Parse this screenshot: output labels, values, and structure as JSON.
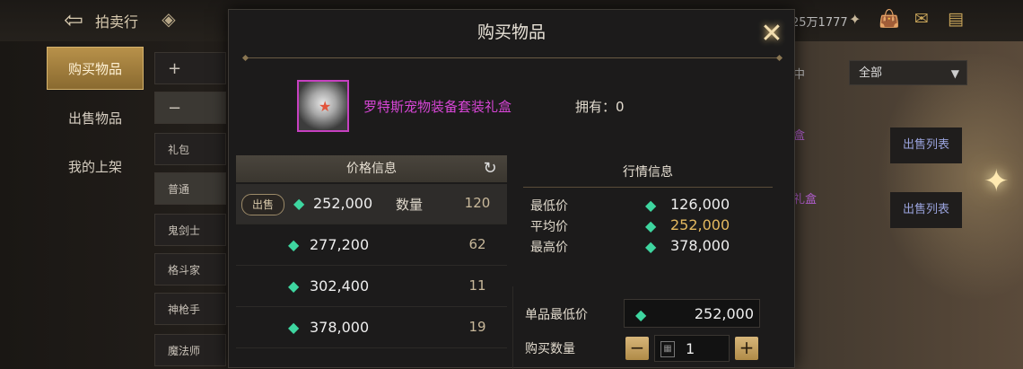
{
  "topbar": {
    "title": "拍卖行",
    "currency": "25万1777"
  },
  "sidebar": {
    "items": [
      {
        "label": "购买物品",
        "active": true
      },
      {
        "label": "出售物品",
        "active": false
      },
      {
        "label": "我的上架",
        "active": false
      }
    ]
  },
  "filters": {
    "plus": "+",
    "minus": "−",
    "items": [
      "礼包",
      "普通",
      "鬼剑士",
      "格斗家",
      "神枪手",
      "魔法师"
    ]
  },
  "right": {
    "partial_label": "中",
    "dropdown": "全部",
    "row1_label": "盒",
    "row2_label": "礼盒",
    "list_button": "出售列表"
  },
  "modal": {
    "title": "购买物品",
    "item_name": "罗特斯宠物装备套装礼盒",
    "owned": "拥有：0",
    "price_info": {
      "header": "价格信息",
      "sell_label": "出售",
      "qty_label": "数量",
      "rows": [
        {
          "price": "252,000",
          "qty": "120"
        },
        {
          "price": "277,200",
          "qty": "62"
        },
        {
          "price": "302,400",
          "qty": "11"
        },
        {
          "price": "378,000",
          "qty": "19"
        }
      ]
    },
    "market": {
      "header": "行情信息",
      "min_label": "最低价",
      "min": "126,000",
      "avg_label": "平均价",
      "avg": "252,000",
      "max_label": "最高价",
      "max": "378,000"
    },
    "unit_min_label": "单品最低价",
    "unit_min": "252,000",
    "buy_qty_label": "购买数量",
    "buy_qty": "1"
  },
  "colors": {
    "item_name": "#d746d6",
    "gem": "#3ed6a0",
    "average": "#e3b85f",
    "active_tab": "#b8914a"
  }
}
